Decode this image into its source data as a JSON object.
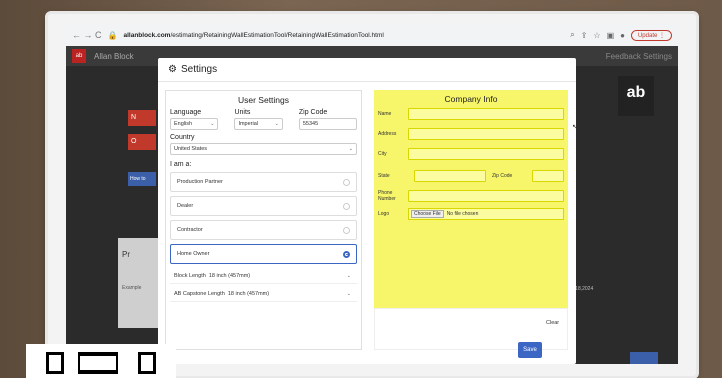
{
  "browser": {
    "nav_glyphs": "← → C",
    "url_host": "allanblock.com",
    "url_path": "/estimating/RetainingWallEstimationTool/RetainingWallEstimationTool.html",
    "update_label": "Update"
  },
  "app": {
    "brand": "Allan Block",
    "right_links": "Feedback  Settings",
    "bg_red_1": "N",
    "bg_red_2": "O",
    "bg_blue": "How to",
    "bg_card_letter": "Pr",
    "bg_card_text": "Example",
    "bg_date": "2/18,2024",
    "logo_text": "ab"
  },
  "modal": {
    "title": "Settings",
    "user_settings": {
      "title": "User Settings",
      "language_label": "Language",
      "language_value": "English",
      "units_label": "Units",
      "units_value": "Imperial",
      "zip_label": "Zip Code",
      "zip_value": "55345",
      "country_label": "Country",
      "country_value": "United States",
      "iam_label": "I am a:",
      "options": [
        "Production Partner",
        "Dealer",
        "Contractor",
        "Home Owner"
      ],
      "selected_option": "Home Owner",
      "block_length_label": "Block Length",
      "block_length_value": "18 inch (457mm)",
      "capstone_label": "AB Capstone Length",
      "capstone_value": "18 inch (457mm)"
    },
    "company_info": {
      "title": "Company Info",
      "name_label": "Name",
      "address_label": "Address",
      "city_label": "City",
      "state_label": "State",
      "zip_label": "Zip Code",
      "phone_label": "Phone Number",
      "logo_label": "Logo",
      "choose_file": "Choose File",
      "no_file": "No file chosen",
      "clear_label": "Clear"
    },
    "save_label": "Save"
  }
}
